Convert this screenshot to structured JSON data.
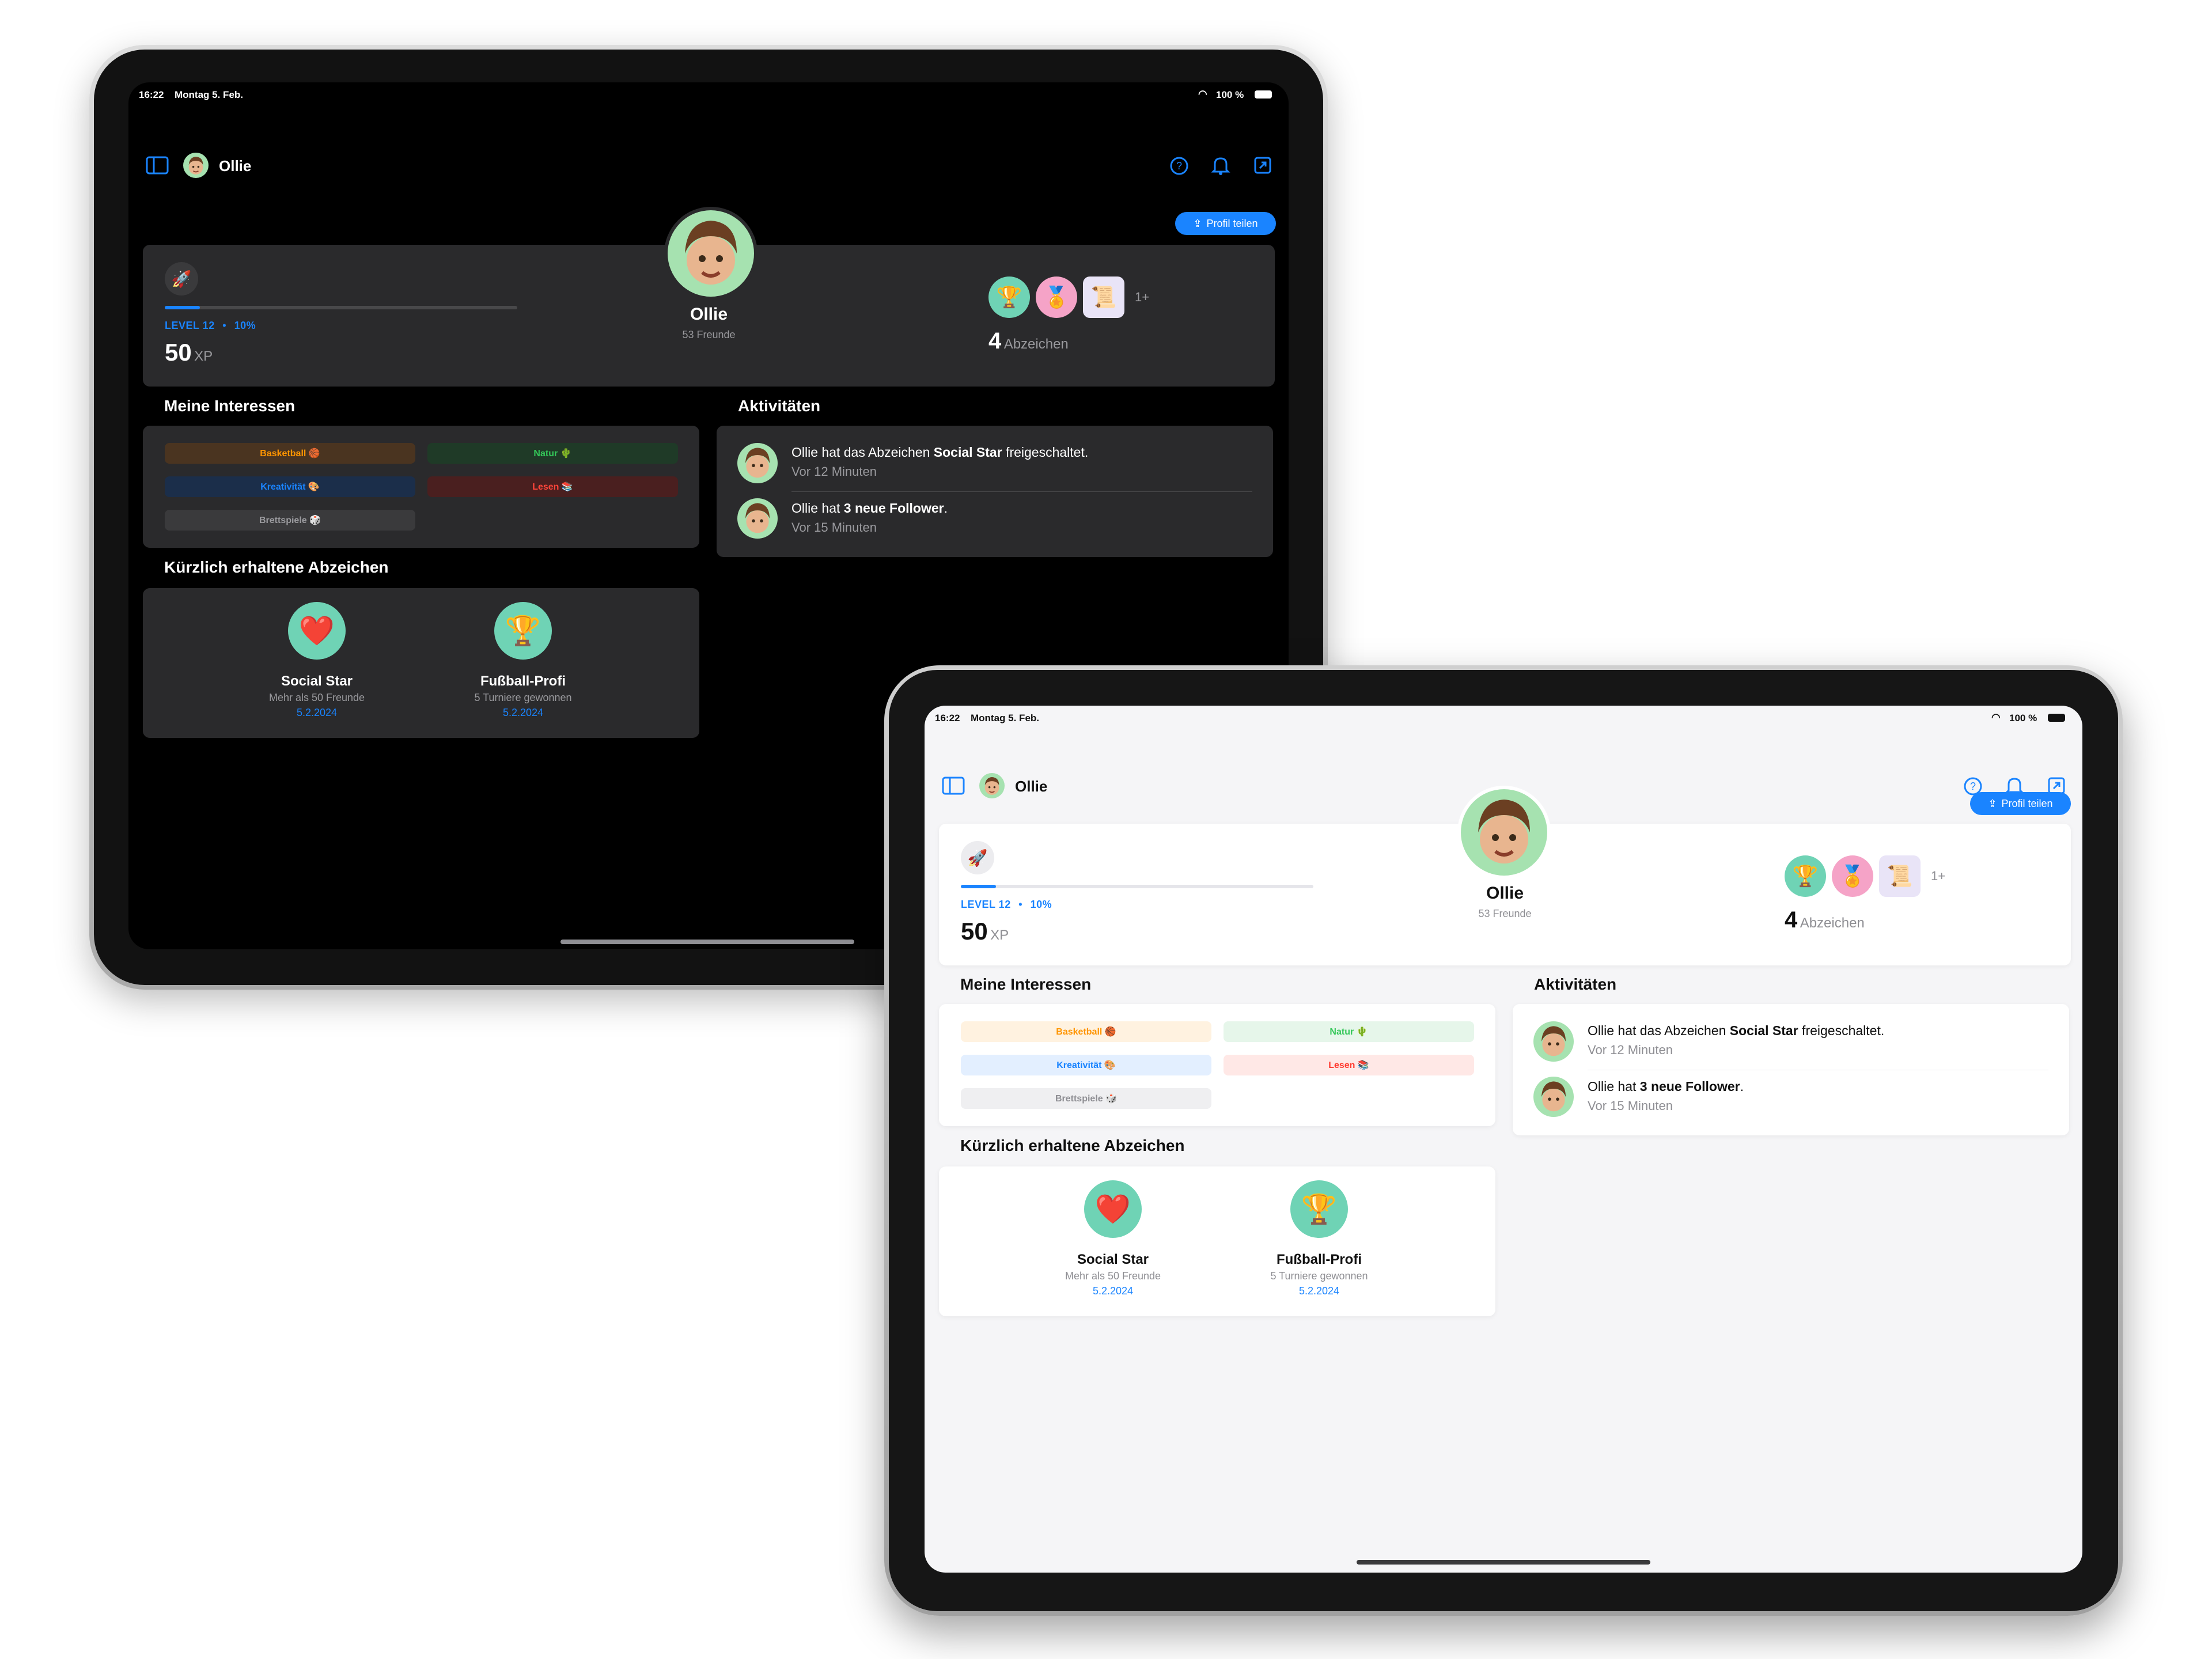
{
  "status": {
    "time": "16:22",
    "date": "Montag 5. Feb.",
    "battery": "100 %"
  },
  "nav": {
    "title": "Ollie",
    "icons": [
      "sidebar-icon",
      "help-icon",
      "bell-icon",
      "share-out-icon"
    ]
  },
  "share_button": "Profil teilen",
  "profile": {
    "name": "Ollie",
    "friends": "53 Freunde",
    "level_label": "LEVEL 12",
    "level_percent": "10%",
    "level_sep": "•",
    "level_progress": 0.1,
    "xp_value": "50",
    "xp_unit": "XP",
    "badges_more": "1+",
    "badges_count": "4",
    "badges_label": "Abzeichen"
  },
  "interests": {
    "title": "Meine Interessen",
    "items": [
      {
        "label": "Basketball 🏀",
        "color": "#ff9500"
      },
      {
        "label": "Natur 🌵",
        "color": "#34c759"
      },
      {
        "label": "Kreativität 🎨",
        "color": "#1a84ff"
      },
      {
        "label": "Lesen 📚",
        "color": "#ff3b30"
      },
      {
        "label": "Brettspiele 🎲",
        "color": "#8e8e93"
      }
    ]
  },
  "activities": {
    "title": "Aktivitäten",
    "items": [
      {
        "prefix": "Ollie hat das Abzeichen ",
        "bold": "Social Star",
        "suffix": " freigeschaltet.",
        "time": "Vor 12 Minuten"
      },
      {
        "prefix": "Ollie hat ",
        "bold": "3 neue Follower",
        "suffix": ".",
        "time": "Vor 15 Minuten"
      }
    ]
  },
  "recent_badges": {
    "title": "Kürzlich erhaltene Abzeichen",
    "items": [
      {
        "name": "Social Star",
        "desc": "Mehr als 50 Freunde",
        "date": "5.2.2024"
      },
      {
        "name": "Fußball-Profi",
        "desc": "5 Turniere gewonnen",
        "date": "5.2.2024"
      }
    ]
  },
  "colors": {
    "accent": "#1a84ff",
    "avatar_bg": "#a6e2b0",
    "dark_bg": "#000000",
    "dark_card": "#2a2a2c",
    "light_bg": "#f5f5f7"
  }
}
